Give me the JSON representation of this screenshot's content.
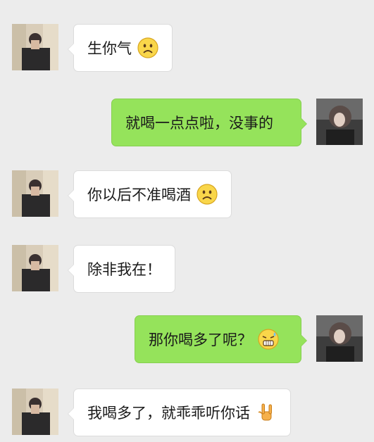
{
  "messages": [
    {
      "side": "left",
      "text": "生你气",
      "emoji": "frowning-face-icon"
    },
    {
      "side": "right",
      "text": "就喝一点点啦，没事的",
      "emoji": ""
    },
    {
      "side": "left",
      "text": "你以后不准喝酒",
      "emoji": "frowning-face-icon"
    },
    {
      "side": "left",
      "text": "除非我在！",
      "emoji": ""
    },
    {
      "side": "right",
      "text": "那你喝多了呢？",
      "emoji": "sweating-grin-face-icon"
    },
    {
      "side": "left",
      "text": "我喝多了，就乖乖听你话",
      "emoji": "rock-hand-icon"
    }
  ],
  "colors": {
    "background": "#ececec",
    "incoming_bubble": "#ffffff",
    "outgoing_bubble": "#95e35b"
  }
}
